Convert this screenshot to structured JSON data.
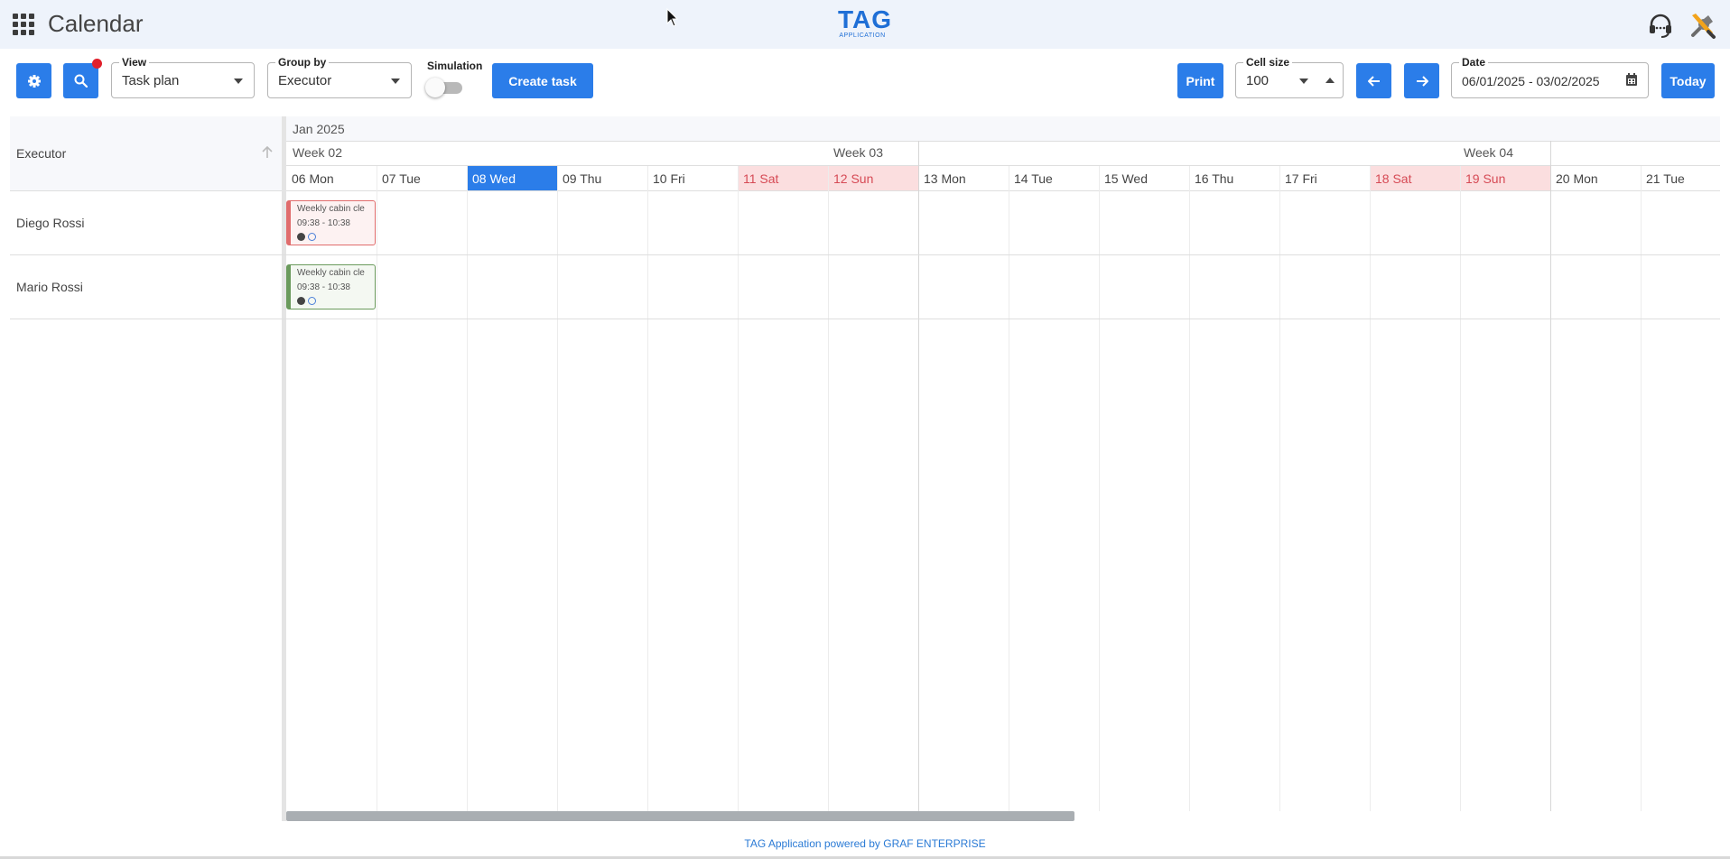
{
  "header": {
    "app_title": "Calendar",
    "logo_main": "TAG",
    "logo_sub": "APPLICATION"
  },
  "toolbar": {
    "view_legend": "View",
    "view_value": "Task plan",
    "groupby_legend": "Group by",
    "groupby_value": "Executor",
    "simulation_label": "Simulation",
    "simulation_on": false,
    "create_task_label": "Create task",
    "print_label": "Print",
    "cellsize_legend": "Cell size",
    "cellsize_value": "100",
    "date_legend": "Date",
    "date_value": "06/01/2025 - 03/02/2025",
    "today_label": "Today",
    "search_has_filter_badge": true
  },
  "grid": {
    "executor_header": "Executor",
    "month": "Jan 2025",
    "weeks": [
      "Week 02",
      "Week 03",
      "Week 04"
    ],
    "days": [
      {
        "label": "06 Mon",
        "kind": "normal"
      },
      {
        "label": "07 Tue",
        "kind": "normal"
      },
      {
        "label": "08 Wed",
        "kind": "today"
      },
      {
        "label": "09 Thu",
        "kind": "normal"
      },
      {
        "label": "10 Fri",
        "kind": "normal"
      },
      {
        "label": "11 Sat",
        "kind": "weekend"
      },
      {
        "label": "12 Sun",
        "kind": "weekend"
      },
      {
        "label": "13 Mon",
        "kind": "normal"
      },
      {
        "label": "14 Tue",
        "kind": "normal"
      },
      {
        "label": "15 Wed",
        "kind": "normal"
      },
      {
        "label": "16 Thu",
        "kind": "normal"
      },
      {
        "label": "17 Fri",
        "kind": "normal"
      },
      {
        "label": "18 Sat",
        "kind": "weekend"
      },
      {
        "label": "19 Sun",
        "kind": "weekend"
      },
      {
        "label": "20 Mon",
        "kind": "normal"
      },
      {
        "label": "21 Tue",
        "kind": "normal"
      }
    ],
    "rows": [
      {
        "executor": "Diego Rossi",
        "task": {
          "title": "Weekly cabin cle",
          "time": "09:38 - 10:38",
          "color": "#e06c6c"
        }
      },
      {
        "executor": "Mario Rossi",
        "task": {
          "title": "Weekly cabin cle",
          "time": "09:38 - 10:38",
          "color": "#6a9a5c"
        }
      }
    ]
  },
  "footer": {
    "text": "TAG Application powered by GRAF ENTERPRISE"
  },
  "colors": {
    "primary": "#2b7de9",
    "weekend_bg": "#fbdedf",
    "weekend_text": "#d64a55",
    "header_bg": "#eef3fb"
  }
}
